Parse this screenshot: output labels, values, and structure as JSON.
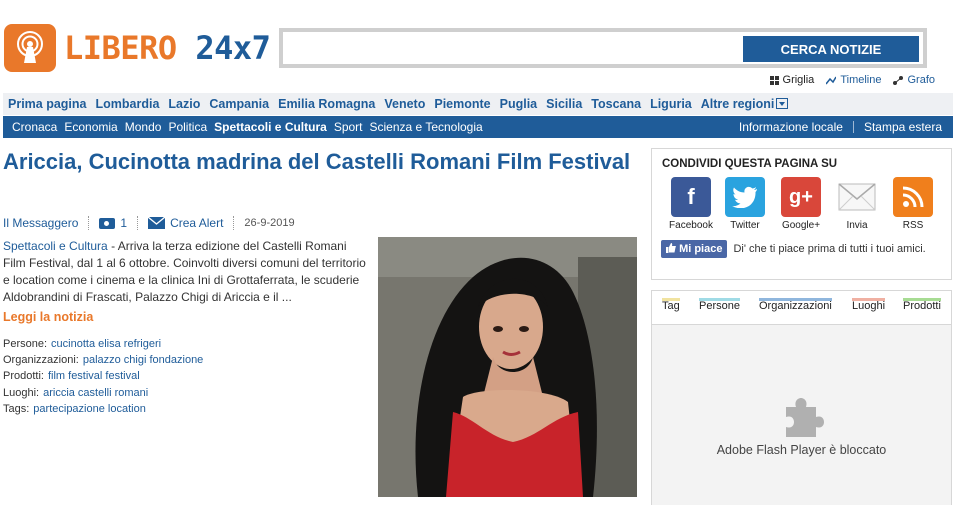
{
  "header": {
    "logo_part1": "LIBERO",
    "logo_part2": "24x7",
    "search_placeholder": "",
    "search_button": "CERCA NOTIZIE",
    "views": [
      "Griglia",
      "Timeline",
      "Grafo"
    ]
  },
  "region_nav": [
    "Prima pagina",
    "Lombardia",
    "Lazio",
    "Campania",
    "Emilia Romagna",
    "Veneto",
    "Piemonte",
    "Puglia",
    "Sicilia",
    "Toscana",
    "Liguria",
    "Altre regioni"
  ],
  "section_nav": {
    "items": [
      "Cronaca",
      "Economia",
      "Mondo",
      "Politica",
      "Spettacoli e Cultura",
      "Sport",
      "Scienza e Tecnologia"
    ],
    "active": "Spettacoli e Cultura",
    "right": [
      "Informazione locale",
      "Stampa estera"
    ]
  },
  "article": {
    "title": "Ariccia, Cucinotta madrina del Castelli Romani Film Festival",
    "source": "Il Messaggero",
    "photo_count": "1",
    "alert_label": "Crea Alert",
    "date": "26-9-2019",
    "category": "Spettacoli e Cultura",
    "summary": " - Arriva la terza edizione del Castelli Romani Film Festival, dal 1 al 6 ottobre. Coinvolti diversi comuni del territorio e location come i cinema e la clinica Ini di Grottaferrata, le scuderie Aldobrandini di Frascati, Palazzo Chigi di Ariccia e il ...",
    "read_more": "Leggi la notizia",
    "tags": [
      {
        "label": "Persone:",
        "value": "cucinotta elisa refrigeri"
      },
      {
        "label": "Organizzazioni:",
        "value": "palazzo chigi fondazione"
      },
      {
        "label": "Prodotti:",
        "value": "film festival festival"
      },
      {
        "label": "Luoghi:",
        "value": "ariccia castelli romani"
      },
      {
        "label": "Tags:",
        "value": "partecipazione location"
      }
    ]
  },
  "share": {
    "heading": "CONDIVIDI QUESTA PAGINA SU",
    "buttons": [
      {
        "label": "Facebook",
        "glyph": "f",
        "color": "#3b5998"
      },
      {
        "label": "Twitter",
        "glyph": "t",
        "color": "#2aa3df"
      },
      {
        "label": "Google+",
        "glyph": "g+",
        "color": "#d9473a"
      },
      {
        "label": "Invia",
        "glyph": "",
        "color": "#ffffff"
      },
      {
        "label": "RSS",
        "glyph": "",
        "color": "#f07f1c"
      }
    ],
    "like_button": "Mi piace",
    "like_text": "Di' che ti piace prima di tutti i tuoi amici."
  },
  "tag_tabs": [
    {
      "label": "Tag",
      "color": "#f1e3a0"
    },
    {
      "label": "Persone",
      "color": "#9fdbe6"
    },
    {
      "label": "Organizzazioni",
      "color": "#8fb6dd"
    },
    {
      "label": "Luoghi",
      "color": "#f0b0a2"
    },
    {
      "label": "Prodotti",
      "color": "#a7dc93"
    }
  ],
  "flash_message": "Adobe Flash Player è bloccato"
}
